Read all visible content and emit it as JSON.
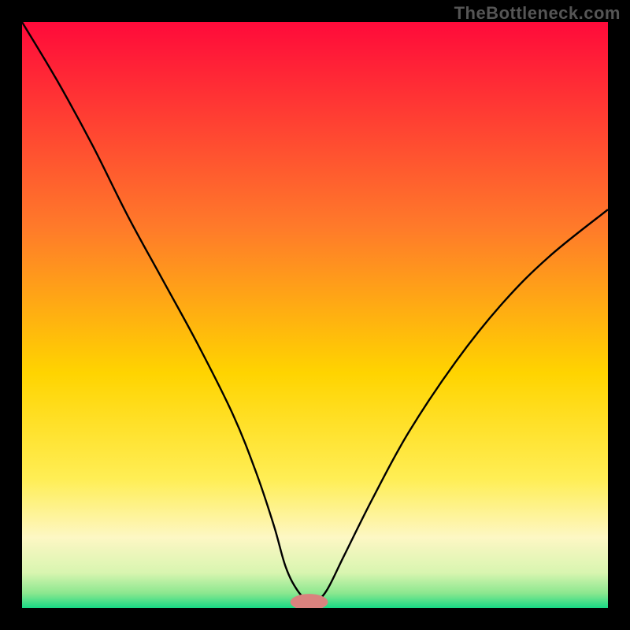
{
  "watermark": "TheBottleneck.com",
  "colors": {
    "frame": "#000000",
    "watermark": "#555555",
    "curve": "#000000",
    "marker": "#d9827e",
    "gradient_stops": [
      {
        "offset": 0.0,
        "color": "#ff0a3a"
      },
      {
        "offset": 0.35,
        "color": "#ff7a2a"
      },
      {
        "offset": 0.6,
        "color": "#ffd400"
      },
      {
        "offset": 0.78,
        "color": "#ffee55"
      },
      {
        "offset": 0.88,
        "color": "#fdf7c4"
      },
      {
        "offset": 0.94,
        "color": "#d8f5b0"
      },
      {
        "offset": 0.975,
        "color": "#8be78f"
      },
      {
        "offset": 1.0,
        "color": "#18d884"
      }
    ]
  },
  "chart_data": {
    "type": "line",
    "title": "",
    "xlabel": "",
    "ylabel": "",
    "xlim": [
      0,
      100
    ],
    "ylim": [
      0,
      100
    ],
    "series": [
      {
        "name": "bottleneck-curve",
        "x": [
          0,
          6,
          12,
          18,
          24,
          30,
          36,
          40,
          43,
          45,
          47,
          49,
          50,
          52,
          55,
          60,
          66,
          74,
          82,
          90,
          100
        ],
        "y": [
          100,
          90,
          79,
          67,
          56,
          45,
          33,
          23,
          14,
          7,
          3,
          1,
          1,
          3,
          9,
          19,
          30,
          42,
          52,
          60,
          68
        ]
      }
    ],
    "marker": {
      "x": 49,
      "y": 1,
      "rx": 3.2,
      "ry": 1.4
    },
    "notes": "Background is a vertical rainbow heat gradient (red at top → green at bottom). Curve is a V-shape dipping to ~0 near x≈49. Values estimated from pixels; no axes/ticks rendered."
  }
}
